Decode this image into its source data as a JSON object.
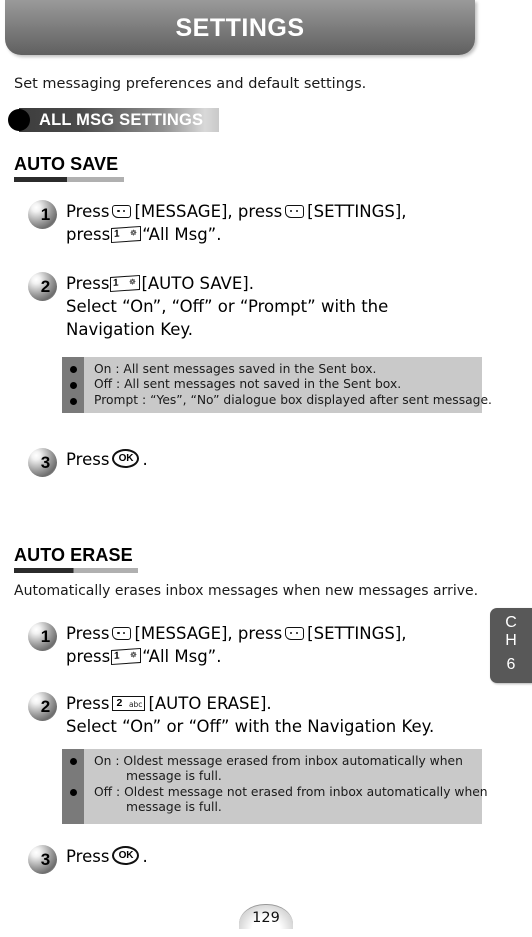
{
  "header": {
    "title": "SETTINGS"
  },
  "intro": "Set messaging preferences and default settings.",
  "banner": {
    "label": "ALL MSG SETTINGS"
  },
  "sections": [
    {
      "heading": "AUTO SAVE",
      "steps": [
        {
          "number": "1",
          "line1_a": "Press",
          "line1_b": "[MESSAGE], press",
          "line1_c": "[SETTINGS],",
          "line2_a": "press",
          "line2_b": "“All Msg”."
        },
        {
          "number": "2",
          "line1_a": "Press",
          "line1_b": "[AUTO SAVE].",
          "line2": "Select “On”, “Off” or “Prompt” with the",
          "line3": "Navigation Key."
        },
        {
          "number": "3",
          "line1_a": "Press",
          "line1_b": "."
        }
      ],
      "note": [
        "On : All sent messages saved in the Sent box.",
        "Off : All sent messages not saved in the Sent box.",
        "Prompt : “Yes”, “No” dialogue box displayed after sent message."
      ]
    },
    {
      "heading": "AUTO ERASE",
      "description": "Automatically erases inbox messages when new messages arrive.",
      "steps": [
        {
          "number": "1",
          "line1_a": "Press",
          "line1_b": "[MESSAGE], press",
          "line1_c": "[SETTINGS],",
          "line2_a": "press",
          "line2_b": "“All Msg”."
        },
        {
          "number": "2",
          "line1_a": "Press",
          "line1_b": "[AUTO ERASE].",
          "line2": "Select “On” or “Off” with the Navigation Key."
        },
        {
          "number": "3",
          "line1_a": "Press",
          "line1_b": "."
        }
      ],
      "note": [
        "On : Oldest message erased from inbox automatically when",
        "message is full.",
        "Off : Oldest message not erased from inbox automatically when",
        "message is full."
      ]
    }
  ],
  "keys": {
    "soft_key": "soft-key-icon",
    "key_1": {
      "digit": "1",
      "sub": "☸"
    },
    "key_2": {
      "digit": "2",
      "sub": "abc"
    },
    "ok_key": "OK"
  },
  "chapter_tab": {
    "line1": "C",
    "line2": "H",
    "number": "6"
  },
  "page_number": "129"
}
